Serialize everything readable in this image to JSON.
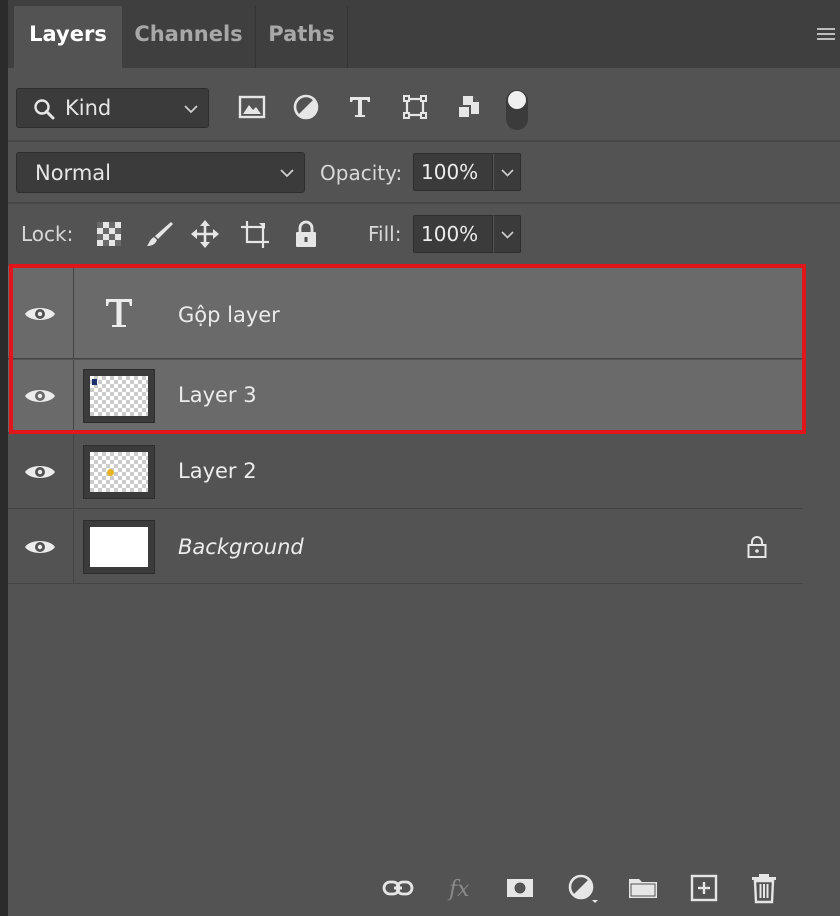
{
  "tabs": [
    {
      "label": "Layers",
      "active": true
    },
    {
      "label": "Channels",
      "active": false
    },
    {
      "label": "Paths",
      "active": false
    }
  ],
  "filter": {
    "kind_label": "Kind",
    "icons": [
      "image-filter-icon",
      "adjustment-filter-icon",
      "type-filter-icon",
      "shape-filter-icon",
      "smart-object-filter-icon"
    ],
    "toggle_on": true
  },
  "blend": {
    "mode": "Normal",
    "opacity_label": "Opacity:",
    "opacity_value": "100%"
  },
  "lock": {
    "label": "Lock:",
    "icons": [
      "lock-transparent-pixels-icon",
      "lock-image-pixels-icon",
      "lock-position-icon",
      "lock-artboard-icon",
      "lock-all-icon"
    ],
    "fill_label": "Fill:",
    "fill_value": "100%"
  },
  "layers": [
    {
      "name": "Gộp layer",
      "type": "text",
      "selected": true,
      "italic": false,
      "locked": false
    },
    {
      "name": "Layer 3",
      "type": "pixel",
      "selected": true,
      "italic": false,
      "locked": false
    },
    {
      "name": "Layer 2",
      "type": "pixel",
      "selected": false,
      "italic": false,
      "locked": false
    },
    {
      "name": "Background",
      "type": "background",
      "selected": false,
      "italic": true,
      "locked": true
    }
  ],
  "bottom_icons": [
    "link-layers-icon",
    "fx-icon",
    "add-mask-icon",
    "adjustment-layer-icon",
    "new-group-icon",
    "new-layer-icon",
    "delete-icon"
  ],
  "colors": {
    "panel_bg": "#535353",
    "selected_row": "#6a6a6a",
    "highlight_border": "#e0161b"
  }
}
